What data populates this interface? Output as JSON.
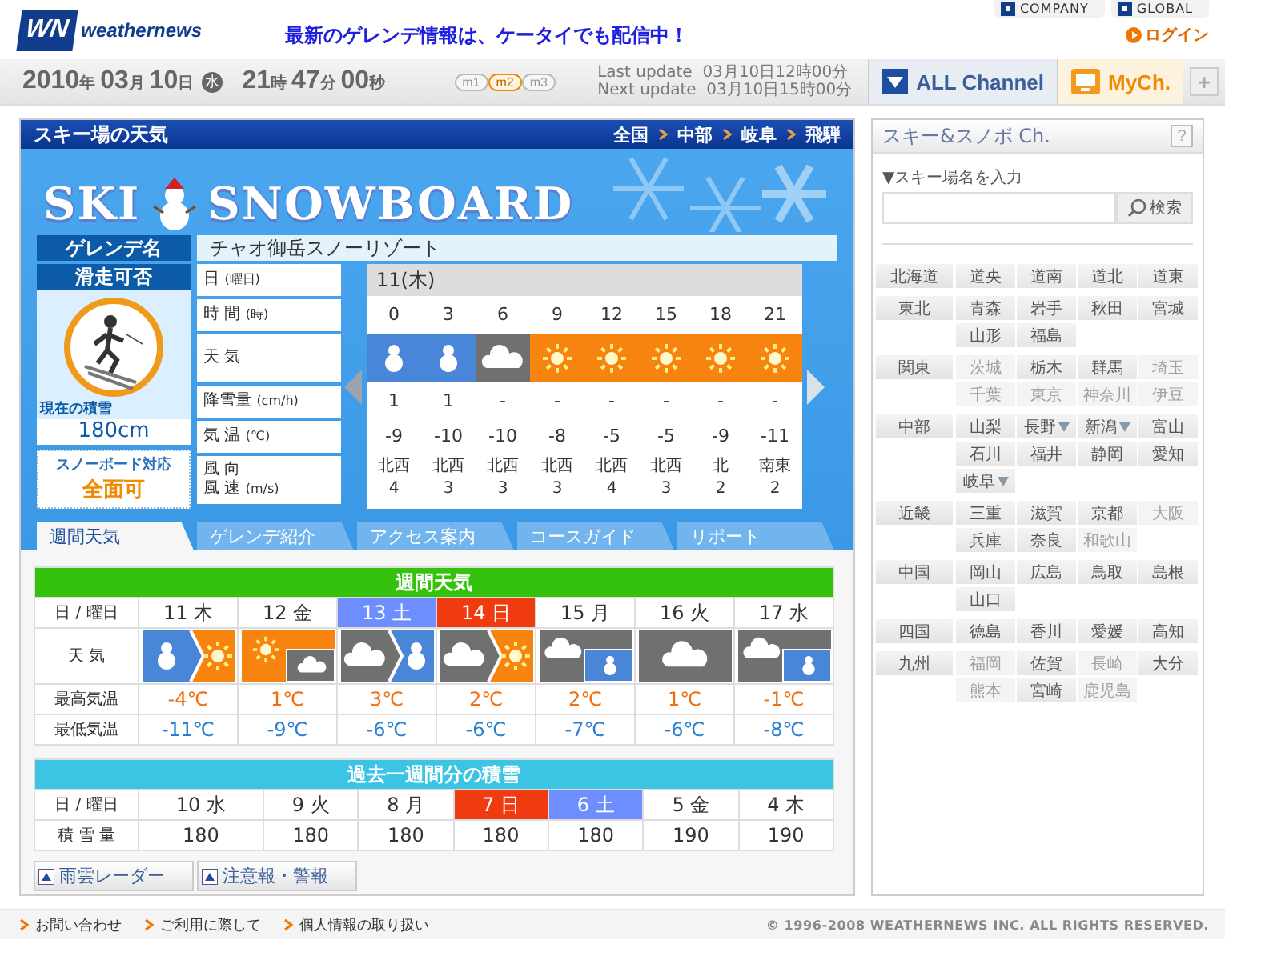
{
  "header": {
    "logo_mark": "WN",
    "logo": "weathernews",
    "promo": "最新のゲレンデ情報は、ケータイでも配信中！",
    "links": [
      "COMPANY",
      "GLOBAL"
    ],
    "login": "ログイン"
  },
  "datebar": {
    "date": [
      {
        "num": "2010",
        "unit": "年"
      },
      {
        "num": "03",
        "unit": "月"
      },
      {
        "num": "10",
        "unit": "日"
      }
    ],
    "weekday": "水",
    "time": [
      {
        "num": "21",
        "unit": "時"
      },
      {
        "num": "47",
        "unit": "分"
      },
      {
        "num": "00",
        "unit": "秒"
      }
    ],
    "sizes": [
      {
        "label": "m1",
        "selected": false
      },
      {
        "label": "m2",
        "selected": true
      },
      {
        "label": "m3",
        "selected": false
      }
    ],
    "updates": [
      {
        "label": "Last update",
        "value": "03月10日12時00分"
      },
      {
        "label": "Next update",
        "value": "03月10日15時00分"
      }
    ],
    "channels": [
      {
        "label": "ALL Channel",
        "kind": "all"
      },
      {
        "label": "MyCh.",
        "kind": "my"
      }
    ],
    "add": "+"
  },
  "panel": {
    "title": "スキー場の天気",
    "breadcrumbs": [
      "全国",
      "中部",
      "岐阜",
      "飛騨"
    ],
    "banner": [
      "SKI",
      "SNOWBOARD"
    ]
  },
  "resort": {
    "label": "ゲレンデ名",
    "name": "チャオ御岳スノーリゾート"
  },
  "status": {
    "label": "滑走可否",
    "snow_label": "現在の積雪",
    "snow_depth": "180cm",
    "board_label": "スノーボード対応",
    "board_value": "全面可"
  },
  "hourly": {
    "date": "11(木)",
    "prev_disabled": false,
    "next_disabled": true,
    "labels": [
      {
        "lines": [
          {
            "text": "日",
            "unit": "(曜日)"
          }
        ]
      },
      {
        "lines": [
          {
            "text": "時 間",
            "unit": "(時)"
          }
        ]
      },
      {
        "lines": [
          {
            "text": "天 気"
          }
        ]
      },
      {
        "lines": [
          {
            "text": "降雪量",
            "unit": "(cm/h)"
          }
        ]
      },
      {
        "lines": [
          {
            "text": "気 温",
            "unit": "(℃)"
          }
        ]
      },
      {
        "lines": [
          {
            "text": "風 向"
          },
          {
            "text": "風 速",
            "unit": "(m/s)"
          }
        ]
      }
    ],
    "hours": [
      {
        "time": "0",
        "kind": "snow",
        "snowfall": "1",
        "temp": "-9",
        "wind_dir": "北西",
        "wind_speed": "4"
      },
      {
        "time": "3",
        "kind": "snow",
        "snowfall": "1",
        "temp": "-10",
        "wind_dir": "北西",
        "wind_speed": "3"
      },
      {
        "time": "6",
        "kind": "cloud",
        "snowfall": "-",
        "temp": "-10",
        "wind_dir": "北西",
        "wind_speed": "3"
      },
      {
        "time": "9",
        "kind": "sun",
        "snowfall": "-",
        "temp": "-8",
        "wind_dir": "北西",
        "wind_speed": "3"
      },
      {
        "time": "12",
        "kind": "sun",
        "snowfall": "-",
        "temp": "-5",
        "wind_dir": "北西",
        "wind_speed": "4"
      },
      {
        "time": "15",
        "kind": "sun",
        "snowfall": "-",
        "temp": "-5",
        "wind_dir": "北西",
        "wind_speed": "3"
      },
      {
        "time": "18",
        "kind": "sun",
        "snowfall": "-",
        "temp": "-9",
        "wind_dir": "北",
        "wind_speed": "2"
      },
      {
        "time": "21",
        "kind": "sun",
        "snowfall": "-",
        "temp": "-11",
        "wind_dir": "南東",
        "wind_speed": "2"
      }
    ]
  },
  "tabs": [
    {
      "label": "週間天気",
      "selected": true
    },
    {
      "label": "ゲレンデ紹介",
      "selected": false
    },
    {
      "label": "アクセス案内",
      "selected": false
    },
    {
      "label": "コースガイド",
      "selected": false
    },
    {
      "label": "リポート",
      "selected": false
    }
  ],
  "weekly": {
    "title": "週間天気",
    "labels": {
      "day": "日 / 曜日",
      "weather": "天 気",
      "high": "最高気温",
      "low": "最低気温"
    },
    "days": [
      {
        "day": "11",
        "weekday": "木",
        "kind": "weekday",
        "weather": [
          {
            "kind": "snow"
          },
          {
            "kind": "sun",
            "sometimes": false
          }
        ],
        "high": "-4℃",
        "low": "-11℃"
      },
      {
        "day": "12",
        "weekday": "金",
        "kind": "weekday",
        "weather": [
          {
            "kind": "sun"
          },
          {
            "kind": "cloud",
            "sometimes": true
          }
        ],
        "high": "1℃",
        "low": "-9℃"
      },
      {
        "day": "13",
        "weekday": "土",
        "kind": "saturday",
        "weather": [
          {
            "kind": "cloud"
          },
          {
            "kind": "snow",
            "sometimes": false
          }
        ],
        "high": "3℃",
        "low": "-6℃"
      },
      {
        "day": "14",
        "weekday": "日",
        "kind": "sunday",
        "weather": [
          {
            "kind": "cloud"
          },
          {
            "kind": "sun",
            "sometimes": false
          }
        ],
        "high": "2℃",
        "low": "-6℃"
      },
      {
        "day": "15",
        "weekday": "月",
        "kind": "weekday",
        "weather": [
          {
            "kind": "cloud"
          },
          {
            "kind": "snow",
            "sometimes": true
          }
        ],
        "high": "2℃",
        "low": "-7℃"
      },
      {
        "day": "16",
        "weekday": "火",
        "kind": "weekday",
        "weather": [
          {
            "kind": "cloud"
          }
        ],
        "high": "1℃",
        "low": "-6℃"
      },
      {
        "day": "17",
        "weekday": "水",
        "kind": "weekday",
        "weather": [
          {
            "kind": "cloud"
          },
          {
            "kind": "snow",
            "sometimes": true
          }
        ],
        "high": "-1℃",
        "low": "-8℃"
      }
    ]
  },
  "past": {
    "title": "過去一週間分の積雪",
    "labels": {
      "day": "日 / 曜日",
      "depth": "積 雪 量"
    },
    "days": [
      {
        "day": "10",
        "weekday": "水",
        "kind": "weekday",
        "depth": "180"
      },
      {
        "day": "9",
        "weekday": "火",
        "kind": "weekday",
        "depth": "180"
      },
      {
        "day": "8",
        "weekday": "月",
        "kind": "weekday",
        "depth": "180"
      },
      {
        "day": "7",
        "weekday": "日",
        "kind": "sunday",
        "depth": "180"
      },
      {
        "day": "6",
        "weekday": "土",
        "kind": "saturday",
        "depth": "180"
      },
      {
        "day": "5",
        "weekday": "金",
        "kind": "weekday",
        "depth": "190"
      },
      {
        "day": "4",
        "weekday": "木",
        "kind": "weekday",
        "depth": "190"
      }
    ]
  },
  "links": [
    "雨雲レーダー",
    "注意報・警報"
  ],
  "footer": {
    "links": [
      "お問い合わせ",
      "ご利用に際して",
      "個人情報の取り扱い"
    ],
    "copyright": "© 1996-2008 WEATHERNEWS INC. ALL RIGHTS RESERVED."
  },
  "sidebar": {
    "title": "スキー&スノボ Ch.",
    "help": "?",
    "search_label": "▼スキー場名を入力",
    "search_button": "検索",
    "regions": [
      {
        "name": "北海道",
        "prefs": [
          {
            "name": "道央",
            "disabled": false,
            "dropdown": false
          },
          {
            "name": "道南",
            "disabled": false,
            "dropdown": false
          },
          {
            "name": "道北",
            "disabled": false,
            "dropdown": false
          },
          {
            "name": "道東",
            "disabled": false,
            "dropdown": false
          }
        ]
      },
      {
        "name": "東北",
        "prefs": [
          {
            "name": "青森",
            "disabled": false,
            "dropdown": false
          },
          {
            "name": "岩手",
            "disabled": false,
            "dropdown": false
          },
          {
            "name": "秋田",
            "disabled": false,
            "dropdown": false
          },
          {
            "name": "宮城",
            "disabled": false,
            "dropdown": false
          },
          {
            "name": "山形",
            "disabled": false,
            "dropdown": false
          },
          {
            "name": "福島",
            "disabled": false,
            "dropdown": false
          }
        ]
      },
      {
        "name": "関東",
        "prefs": [
          {
            "name": "茨城",
            "disabled": true,
            "dropdown": false
          },
          {
            "name": "栃木",
            "disabled": false,
            "dropdown": false
          },
          {
            "name": "群馬",
            "disabled": false,
            "dropdown": false
          },
          {
            "name": "埼玉",
            "disabled": true,
            "dropdown": false
          },
          {
            "name": "千葉",
            "disabled": true,
            "dropdown": false
          },
          {
            "name": "東京",
            "disabled": true,
            "dropdown": false
          },
          {
            "name": "神奈川",
            "disabled": true,
            "dropdown": false
          },
          {
            "name": "伊豆",
            "disabled": true,
            "dropdown": false
          }
        ]
      },
      {
        "name": "中部",
        "prefs": [
          {
            "name": "山梨",
            "disabled": false,
            "dropdown": false
          },
          {
            "name": "長野",
            "disabled": false,
            "dropdown": true
          },
          {
            "name": "新潟",
            "disabled": false,
            "dropdown": true
          },
          {
            "name": "富山",
            "disabled": false,
            "dropdown": false
          },
          {
            "name": "石川",
            "disabled": false,
            "dropdown": false
          },
          {
            "name": "福井",
            "disabled": false,
            "dropdown": false
          },
          {
            "name": "静岡",
            "disabled": false,
            "dropdown": false
          },
          {
            "name": "愛知",
            "disabled": false,
            "dropdown": false
          },
          {
            "name": "岐阜",
            "disabled": false,
            "dropdown": true
          }
        ]
      },
      {
        "name": "近畿",
        "prefs": [
          {
            "name": "三重",
            "disabled": false,
            "dropdown": false
          },
          {
            "name": "滋賀",
            "disabled": false,
            "dropdown": false
          },
          {
            "name": "京都",
            "disabled": false,
            "dropdown": false
          },
          {
            "name": "大阪",
            "disabled": true,
            "dropdown": false
          },
          {
            "name": "兵庫",
            "disabled": false,
            "dropdown": false
          },
          {
            "name": "奈良",
            "disabled": false,
            "dropdown": false
          },
          {
            "name": "和歌山",
            "disabled": true,
            "dropdown": false
          }
        ]
      },
      {
        "name": "中国",
        "prefs": [
          {
            "name": "岡山",
            "disabled": false,
            "dropdown": false
          },
          {
            "name": "広島",
            "disabled": false,
            "dropdown": false
          },
          {
            "name": "鳥取",
            "disabled": false,
            "dropdown": false
          },
          {
            "name": "島根",
            "disabled": false,
            "dropdown": false
          },
          {
            "name": "山口",
            "disabled": false,
            "dropdown": false
          }
        ]
      },
      {
        "name": "四国",
        "prefs": [
          {
            "name": "徳島",
            "disabled": false,
            "dropdown": false
          },
          {
            "name": "香川",
            "disabled": false,
            "dropdown": false
          },
          {
            "name": "愛媛",
            "disabled": false,
            "dropdown": false
          },
          {
            "name": "高知",
            "disabled": false,
            "dropdown": false
          }
        ]
      },
      {
        "name": "九州",
        "prefs": [
          {
            "name": "福岡",
            "disabled": true,
            "dropdown": false
          },
          {
            "name": "佐賀",
            "disabled": false,
            "dropdown": false
          },
          {
            "name": "長崎",
            "disabled": true,
            "dropdown": false
          },
          {
            "name": "大分",
            "disabled": false,
            "dropdown": false
          },
          {
            "name": "熊本",
            "disabled": true,
            "dropdown": false
          },
          {
            "name": "宮崎",
            "disabled": false,
            "dropdown": false
          },
          {
            "name": "鹿児島",
            "disabled": true,
            "dropdown": false
          }
        ]
      }
    ]
  }
}
